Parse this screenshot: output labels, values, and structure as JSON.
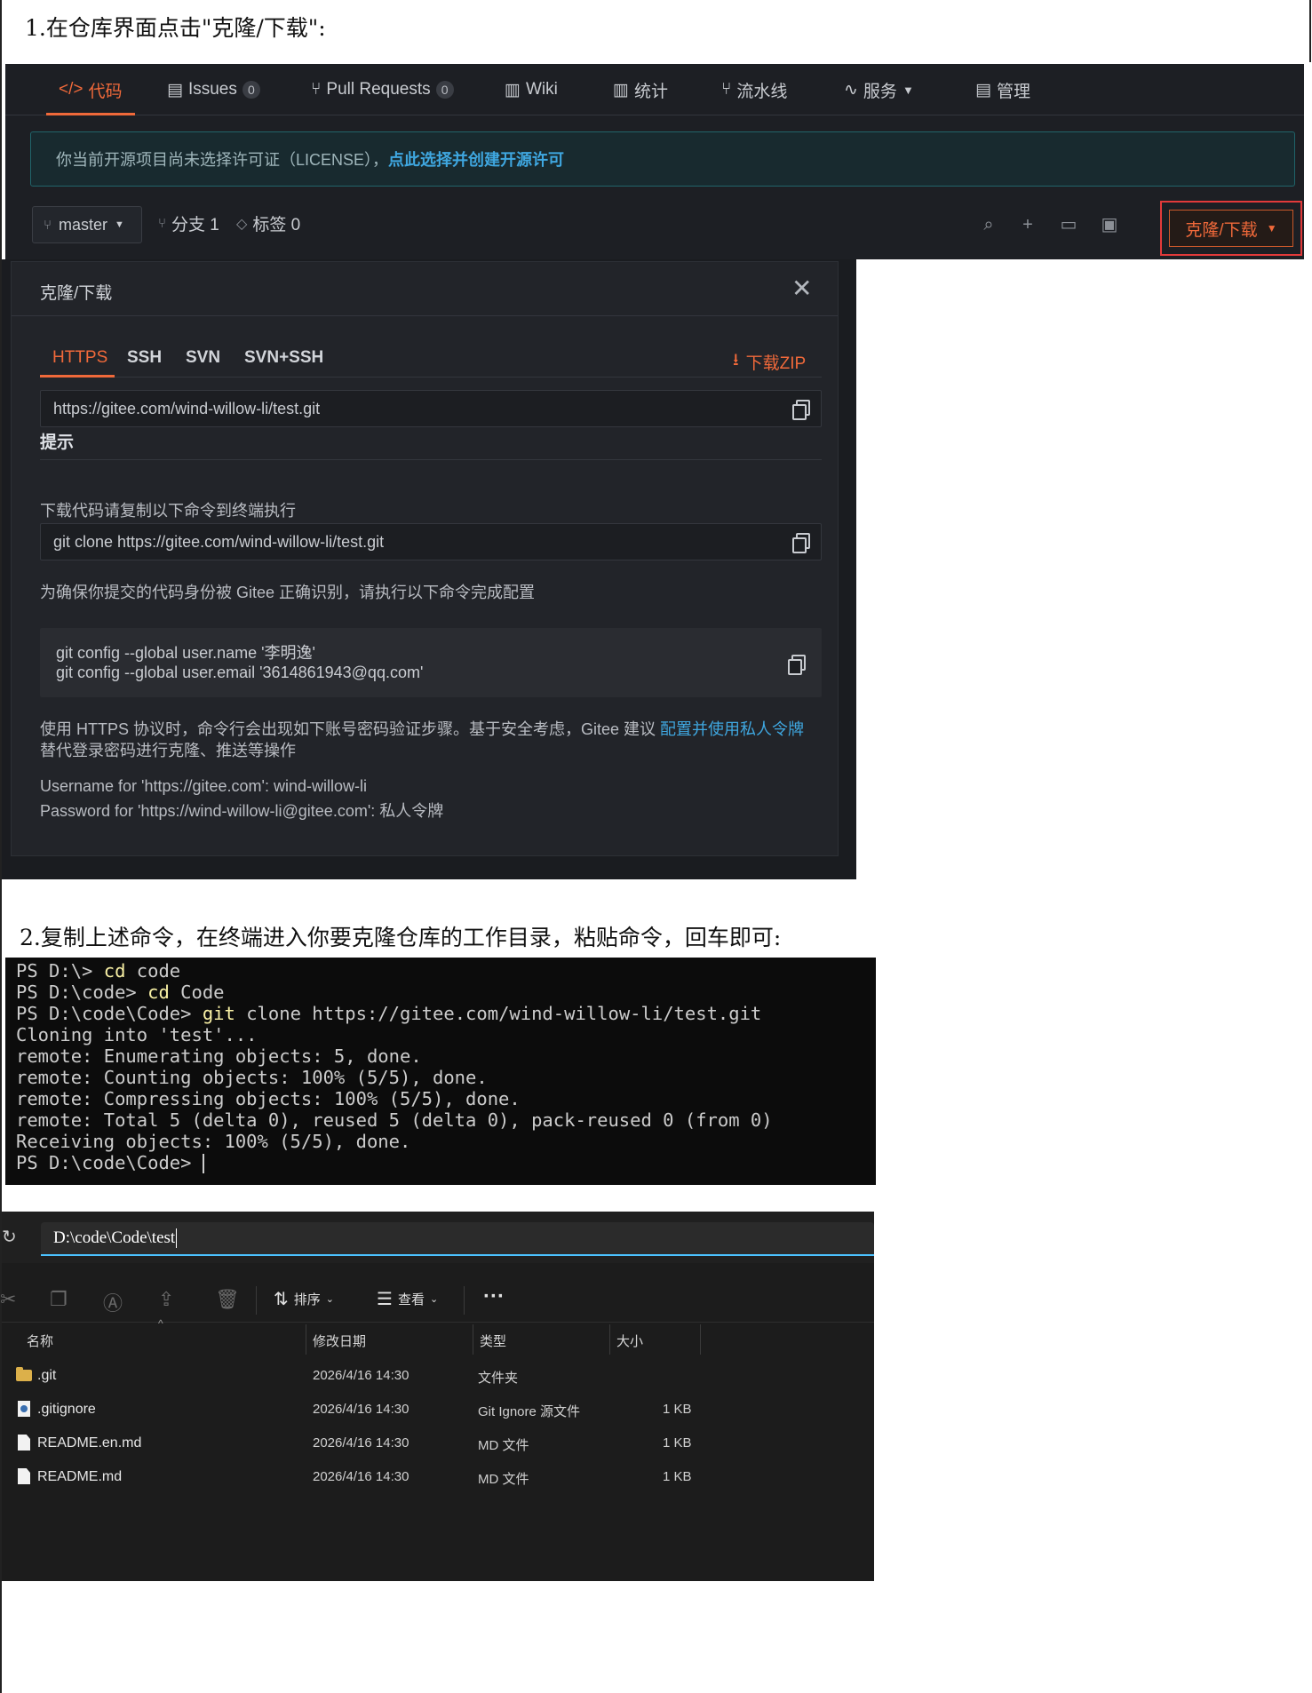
{
  "step1": {
    "title": "1.在仓库界面点击\"克隆/下载\":"
  },
  "step2": {
    "title": "2.复制上述命令，在终端进入你要克隆仓库的工作目录，粘贴命令，回车即可:"
  },
  "gitee": {
    "tabs": [
      {
        "icon": "</>",
        "label": "代码"
      },
      {
        "label": "Issues",
        "count": "0"
      },
      {
        "label": "Pull Requests",
        "count": "0"
      },
      {
        "label": "Wiki"
      },
      {
        "label": "统计"
      },
      {
        "label": "流水线"
      },
      {
        "label": "服务"
      },
      {
        "label": "管理"
      }
    ],
    "license": {
      "text": "你当前开源项目尚未选择许可证（LICENSE），",
      "link": "点此选择并创建开源许可"
    },
    "branch": {
      "current": "master",
      "branches": "分支 1",
      "tags": "标签 0"
    },
    "clone_button": "克隆/下载"
  },
  "clone_panel": {
    "title": "克隆/下载",
    "tabs": [
      "HTTPS",
      "SSH",
      "SVN",
      "SVN+SSH"
    ],
    "download_zip": "下载ZIP",
    "url": "https://gitee.com/wind-willow-li/test.git",
    "hint_title": "提示",
    "hint1": "下载代码请复制以下命令到终端执行",
    "clone_cmd": "git clone https://gitee.com/wind-willow-li/test.git",
    "hint2": "为确保你提交的代码身份被 Gitee 正确识别，请执行以下命令完成配置",
    "config_lines": [
      "git config --global user.name '李明逸'",
      "git config --global user.email '3614861943@qq.com'"
    ],
    "note_line1": "使用 HTTPS 协议时，命令行会出现如下账号密码验证步骤。基于安全考虑，Gitee 建议 ",
    "note_link": "配置并使用私人令牌",
    "note_line2": "替代登录密码进行克隆、推送等操作",
    "username_line": "Username for 'https://gitee.com': wind-willow-li",
    "password_line": "Password for 'https://wind-willow-li@gitee.com': 私人令牌"
  },
  "terminal": {
    "lines": [
      {
        "prompt": "PS D:\\> ",
        "cmd": "cd",
        "rest": " code"
      },
      {
        "prompt": "PS D:\\code> ",
        "cmd": "cd",
        "rest": " Code"
      },
      {
        "prompt": "PS D:\\code\\Code> ",
        "cmd": "git",
        "rest": " clone https://gitee.com/wind-willow-li/test.git"
      },
      {
        "text": "Cloning into 'test'..."
      },
      {
        "text": "remote: Enumerating objects: 5, done."
      },
      {
        "text": "remote: Counting objects: 100% (5/5), done."
      },
      {
        "text": "remote: Compressing objects: 100% (5/5), done."
      },
      {
        "text": "remote: Total 5 (delta 0), reused 5 (delta 0), pack-reused 0 (from 0)"
      },
      {
        "text": "Receiving objects: 100% (5/5), done."
      },
      {
        "prompt": "PS D:\\code\\Code> "
      }
    ]
  },
  "explorer": {
    "path": "D:\\code\\Code\\test",
    "sort_label": "排序",
    "view_label": "查看",
    "columns": [
      "名称",
      "修改日期",
      "类型",
      "大小"
    ],
    "files": [
      {
        "name": ".git",
        "date": "2026/4/16 14:30",
        "type": "文件夹",
        "size": "",
        "icon": "folder-icon"
      },
      {
        "name": ".gitignore",
        "date": "2026/4/16 14:30",
        "type": "Git Ignore 源文件",
        "size": "1 KB",
        "icon": "config-file-icon"
      },
      {
        "name": "README.en.md",
        "date": "2026/4/16 14:30",
        "type": "MD 文件",
        "size": "1 KB",
        "icon": "file-icon"
      },
      {
        "name": "README.md",
        "date": "2026/4/16 14:30",
        "type": "MD 文件",
        "size": "1 KB",
        "icon": "file-icon"
      }
    ]
  },
  "colors": {
    "accent": "#f0693a",
    "link": "#3fa7e0",
    "highlight": "#e23a3a",
    "explorer_focus": "#4cc2ff"
  }
}
